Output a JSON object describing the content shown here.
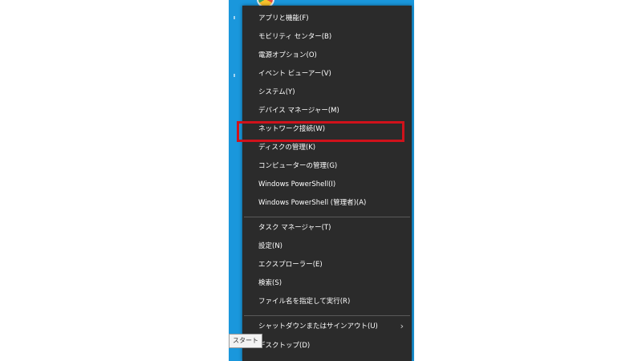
{
  "menu": {
    "items": [
      {
        "label": "アプリと機能(F)"
      },
      {
        "label": "モビリティ センター(B)"
      },
      {
        "label": "電源オプション(O)"
      },
      {
        "label": "イベント ビューアー(V)"
      },
      {
        "label": "システム(Y)"
      },
      {
        "label": "デバイス マネージャー(M)"
      },
      {
        "label": "ネットワーク接続(W)"
      },
      {
        "label": "ディスクの管理(K)"
      },
      {
        "label": "コンピューターの管理(G)"
      },
      {
        "label": "Windows PowerShell(I)"
      },
      {
        "label": "Windows PowerShell (管理者)(A)"
      },
      {
        "label": "タスク マネージャー(T)"
      },
      {
        "label": "設定(N)"
      },
      {
        "label": "エクスプローラー(E)"
      },
      {
        "label": "検索(S)"
      },
      {
        "label": "ファイル名を指定して実行(R)"
      },
      {
        "label": "シャットダウンまたはサインアウト(U)",
        "submenu_icon": "chevron-right-icon"
      },
      {
        "label": "デスクトップ(D)"
      }
    ]
  },
  "highlighted_item": "ネットワーク接続(W)",
  "tooltip": {
    "text": "スタート"
  },
  "colors": {
    "menu_background": "#2b2b2b",
    "highlight_border": "#d0121b",
    "desktop_background": "#1a97dc"
  }
}
